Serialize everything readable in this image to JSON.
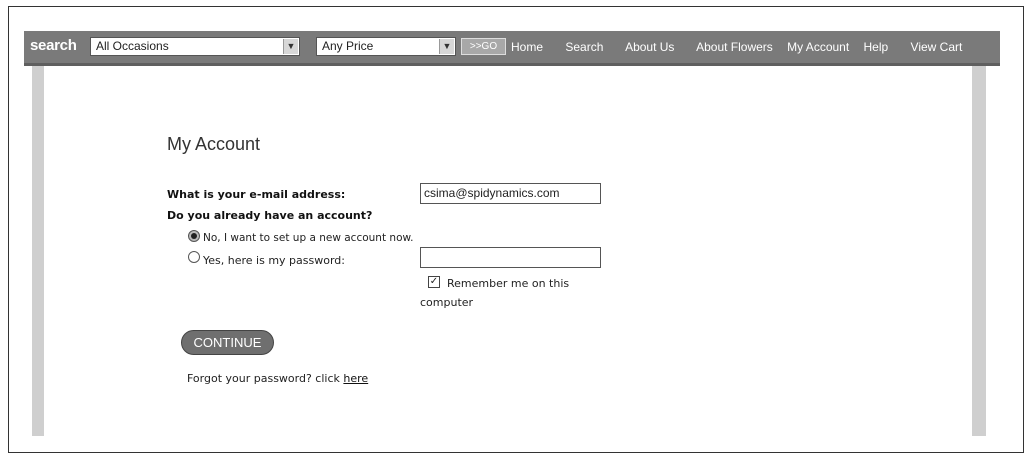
{
  "nav": {
    "brand": "search",
    "occasion_select": "All Occasions",
    "price_select": "Any Price",
    "go_label": ">>GO",
    "links": [
      "Home",
      "Search",
      "About Us",
      "About Flowers",
      "My Account",
      "Help",
      "View Cart"
    ]
  },
  "form": {
    "title": "My Account",
    "email_label": "What is your e-mail address:",
    "email_value": "csima@spidynamics.com",
    "have_account_label": "Do you already have an account?",
    "option_new": "No, I want to set up a new account now.",
    "option_existing": "Yes, here is my password:",
    "password_value": "",
    "remember_line1": "Remember me on this",
    "remember_line2": "computer",
    "continue_label": "CONTINUE",
    "forgot_text": "Forgot your password? click ",
    "forgot_link": "here"
  }
}
